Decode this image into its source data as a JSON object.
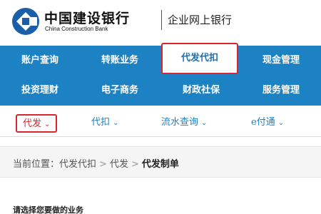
{
  "header": {
    "logo_cn": "中国建设银行",
    "logo_en": "China Construction Bank",
    "title": "企业网上银行"
  },
  "menu": {
    "row1": [
      "账户查询",
      "转账业务",
      "代发代扣",
      "现金管理"
    ],
    "row2": [
      "投资理财",
      "电子商务",
      "财政社保",
      "服务管理"
    ],
    "active": "代发代扣"
  },
  "submenu": {
    "items": [
      "代发",
      "代扣",
      "流水查询",
      "e付通"
    ],
    "active": "代发"
  },
  "breadcrumb": {
    "label": "当前位置：",
    "items": [
      "代发代扣",
      "代发"
    ],
    "current": "代发制单",
    "separator": ">"
  },
  "section": {
    "title": "请选择您要做的业务"
  },
  "colors": {
    "brand_blue": "#1c82c4",
    "highlight_red": "#d9262e"
  }
}
